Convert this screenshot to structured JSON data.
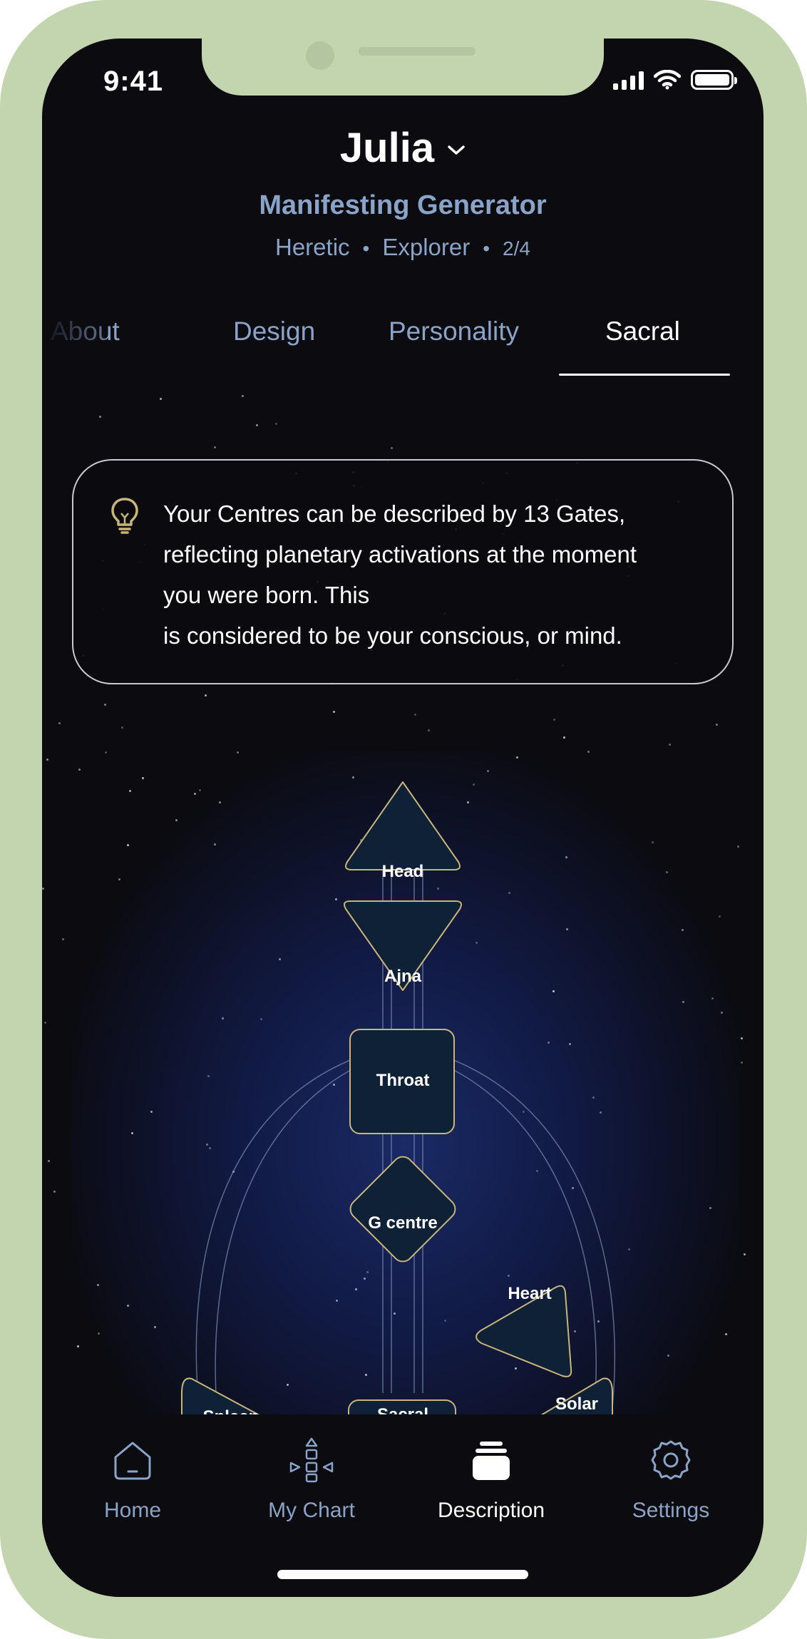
{
  "status_bar": {
    "time": "9:41"
  },
  "profile": {
    "name": "Julia",
    "type": "Manifesting Generator",
    "profile_word_1": "Heretic",
    "profile_word_2": "Explorer",
    "profile_number": "2/4",
    "separator": "•"
  },
  "tabs": [
    {
      "label": "About",
      "active": false
    },
    {
      "label": "Design",
      "active": false
    },
    {
      "label": "Personality",
      "active": false
    },
    {
      "label": "Sacral",
      "active": true
    }
  ],
  "info_card": {
    "icon": "lightbulb-icon",
    "lines": [
      "Your Centres can be described by 13 Gates,",
      "reflecting planetary activations at the moment",
      "you were born. This",
      "is considered to be your conscious, or mind."
    ]
  },
  "bodygraph": {
    "centres": {
      "head": "Head",
      "ajna": "Ajna",
      "throat": "Throat",
      "g_centre": "G centre",
      "heart": "Heart",
      "spleen": "Spleen",
      "sacral": "Sacral",
      "solar": "Solar"
    },
    "centre_fill": "#0f2136",
    "centre_stroke": "#c9b47a"
  },
  "bottom_nav": [
    {
      "label": "Home",
      "icon": "home-icon",
      "active": false
    },
    {
      "label": "My Chart",
      "icon": "chart-shapes-icon",
      "active": false
    },
    {
      "label": "Description",
      "icon": "cards-stack-icon",
      "active": true
    },
    {
      "label": "Settings",
      "icon": "gear-icon",
      "active": false
    }
  ],
  "colors": {
    "background": "#0b0b10",
    "accent_text": "#8aa3c8",
    "frame": "#c3d5af",
    "gold": "#c9b47a"
  }
}
